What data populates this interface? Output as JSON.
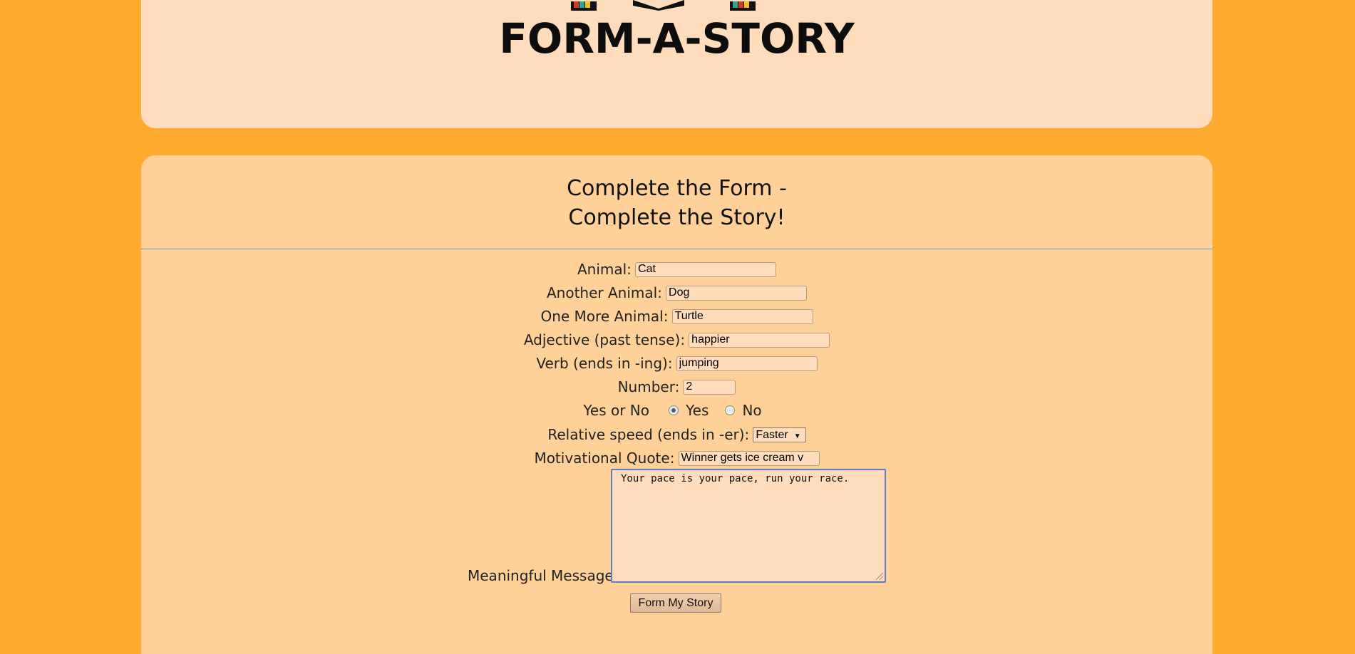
{
  "header": {
    "logo_text": "FORM-A-STORY"
  },
  "form": {
    "title_line1": "Complete the Form -",
    "title_line2": "Complete the Story!",
    "fields": {
      "animal": {
        "label": "Animal:",
        "value": "Cat"
      },
      "another_animal": {
        "label": "Another Animal:",
        "value": "Dog"
      },
      "one_more_animal": {
        "label": "One More Animal:",
        "value": "Turtle"
      },
      "adjective": {
        "label": "Adjective (past tense):",
        "value": "happier"
      },
      "verb": {
        "label": "Verb (ends in -ing):",
        "value": "jumping"
      },
      "number": {
        "label": "Number:",
        "value": "2"
      },
      "yes_no": {
        "label": "Yes or No",
        "yes": "Yes",
        "no": "No",
        "selected": "Yes"
      },
      "speed": {
        "label": "Relative speed (ends in -er):",
        "value": "Faster"
      },
      "quote": {
        "label": "Motivational Quote:",
        "value": "Winner gets ice cream v"
      },
      "message": {
        "label": "Meaningful Message:",
        "value": "Your pace is your pace, run your race."
      }
    },
    "submit_label": "Form My Story"
  },
  "colors": {
    "background": "#ffab30",
    "header_card": "#ffdcbc",
    "form_card": "#ffd198",
    "focus_border": "#5b7fc0"
  }
}
